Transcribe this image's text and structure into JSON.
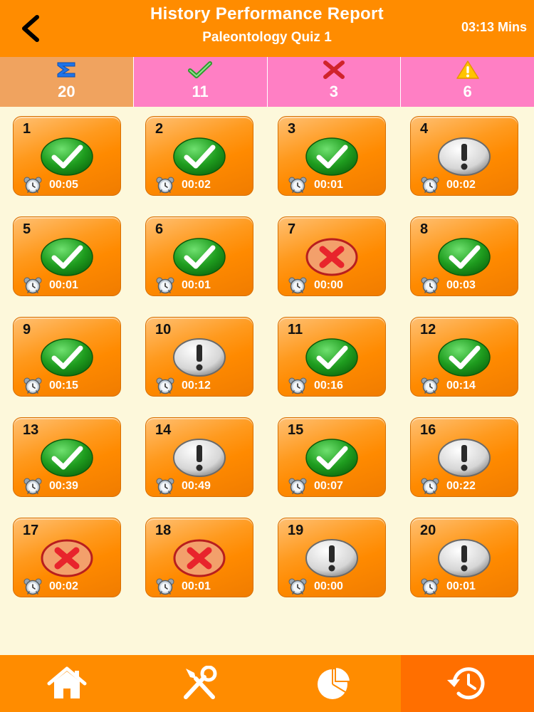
{
  "header": {
    "title": "History Performance Report",
    "subtitle": "Paleontology Quiz 1",
    "timer": "03:13 Mins"
  },
  "summary": {
    "total": "20",
    "correct": "11",
    "wrong": "3",
    "skipped": "6"
  },
  "colors": {
    "orange": "#ff8c00",
    "pink": "#ff7fc4",
    "correct": "#1f9d1f",
    "wrong": "#e23b2f",
    "skipped": "#d9d9d9"
  },
  "questions": [
    {
      "num": "1",
      "status": "correct",
      "time": "00:05"
    },
    {
      "num": "2",
      "status": "correct",
      "time": "00:02"
    },
    {
      "num": "3",
      "status": "correct",
      "time": "00:01"
    },
    {
      "num": "4",
      "status": "skipped",
      "time": "00:02"
    },
    {
      "num": "5",
      "status": "correct",
      "time": "00:01"
    },
    {
      "num": "6",
      "status": "correct",
      "time": "00:01"
    },
    {
      "num": "7",
      "status": "wrong",
      "time": "00:00"
    },
    {
      "num": "8",
      "status": "correct",
      "time": "00:03"
    },
    {
      "num": "9",
      "status": "correct",
      "time": "00:15"
    },
    {
      "num": "10",
      "status": "skipped",
      "time": "00:12"
    },
    {
      "num": "11",
      "status": "correct",
      "time": "00:16"
    },
    {
      "num": "12",
      "status": "correct",
      "time": "00:14"
    },
    {
      "num": "13",
      "status": "correct",
      "time": "00:39"
    },
    {
      "num": "14",
      "status": "skipped",
      "time": "00:49"
    },
    {
      "num": "15",
      "status": "correct",
      "time": "00:07"
    },
    {
      "num": "16",
      "status": "skipped",
      "time": "00:22"
    },
    {
      "num": "17",
      "status": "wrong",
      "time": "00:02"
    },
    {
      "num": "18",
      "status": "wrong",
      "time": "00:01"
    },
    {
      "num": "19",
      "status": "skipped",
      "time": "00:00"
    },
    {
      "num": "20",
      "status": "skipped",
      "time": "00:01"
    }
  ],
  "nav": {
    "items": [
      "home-icon",
      "tools-icon",
      "pie-chart-icon",
      "history-icon"
    ],
    "active": "history-icon"
  }
}
